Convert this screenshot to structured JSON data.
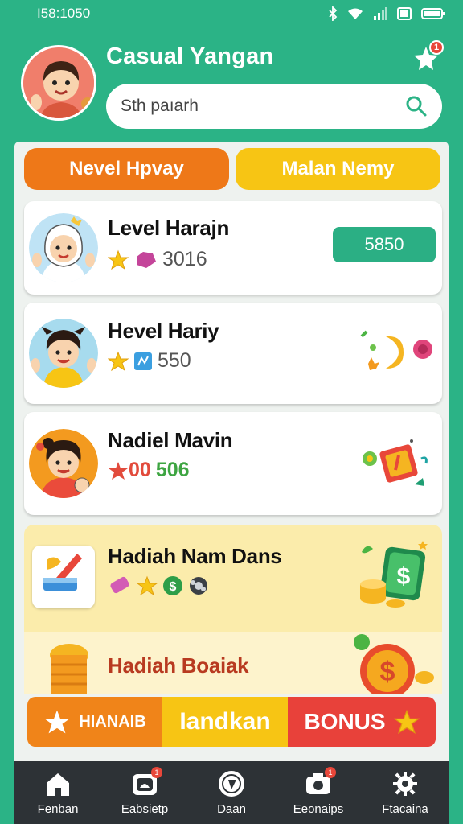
{
  "status_bar": {
    "time": "I58:1050"
  },
  "header": {
    "app_title": "Casual Yangan",
    "notification_count": "1",
    "search_placeholder": "Sth paıarh"
  },
  "tabs": [
    {
      "label": "Nevel Hpvay",
      "color": "#ee7818"
    },
    {
      "label": "Malan Nemy",
      "color": "#f7c514"
    }
  ],
  "cards": [
    {
      "title": "Level Harajn",
      "meta_value": "3016",
      "action_label": "5850"
    },
    {
      "title": "Hevel Hariy",
      "meta_value": "550"
    },
    {
      "title": "Nadiel Mavin",
      "meta_value_red": "00",
      "meta_value_green": "506"
    },
    {
      "title": "Hadiah Nam Dans"
    },
    {
      "title": "Hadiah Boaiak"
    }
  ],
  "banner": {
    "left_label": "HIANAIB",
    "middle_label": "Iandkan",
    "right_label": "BONUS"
  },
  "bottom_nav": [
    {
      "label": "Fenban",
      "icon": "home-icon"
    },
    {
      "label": "Eabsietp",
      "icon": "inbox-icon",
      "badge": "1"
    },
    {
      "label": "Daan",
      "icon": "compass-icon"
    },
    {
      "label": "Eeonaips",
      "icon": "camera-icon",
      "badge": "1"
    },
    {
      "label": "Ftacaina",
      "icon": "gear-icon"
    }
  ],
  "colors": {
    "brand_green": "#2bb386",
    "tab_orange": "#ee7818",
    "tab_yellow": "#f7c514",
    "price_green": "#2baf84",
    "nav_dark": "#2d3236"
  }
}
